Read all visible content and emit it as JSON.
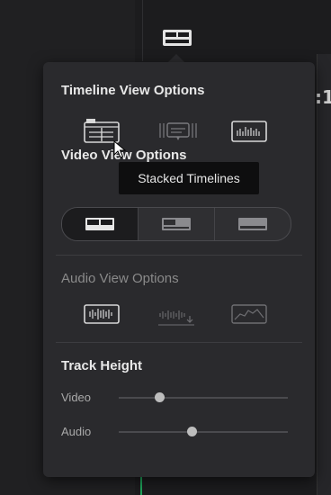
{
  "toolbar": {
    "timeline_view_icon": "stacked-timeline-view-icon"
  },
  "background": {
    "timecode_fragment": ":1"
  },
  "popup": {
    "timeline_view_options": {
      "title": "Timeline View Options",
      "icons": [
        "stacked-timelines-icon",
        "subtitle-track-icon",
        "audio-waveform-icon"
      ]
    },
    "video_view_options": {
      "title": "Video View Options",
      "segments": [
        "thumbnail-strip-icon",
        "filmstrip-icon",
        "simple-icon"
      ],
      "selected_index": 0
    },
    "audio_view_options": {
      "title": "Audio View Options",
      "icons": [
        "waveform-icon",
        "waveform-split-icon",
        "waveform-envelope-icon"
      ]
    },
    "track_height": {
      "title": "Track Height",
      "sliders": [
        {
          "label": "Video",
          "level": 0.24
        },
        {
          "label": "Audio",
          "level": 0.43
        }
      ]
    }
  },
  "tooltip": {
    "text": "Stacked Timelines"
  },
  "colors": {
    "popup_bg": "#2a2a2d",
    "text": "#e8e8e8",
    "accent_green": "#1fa35a"
  }
}
